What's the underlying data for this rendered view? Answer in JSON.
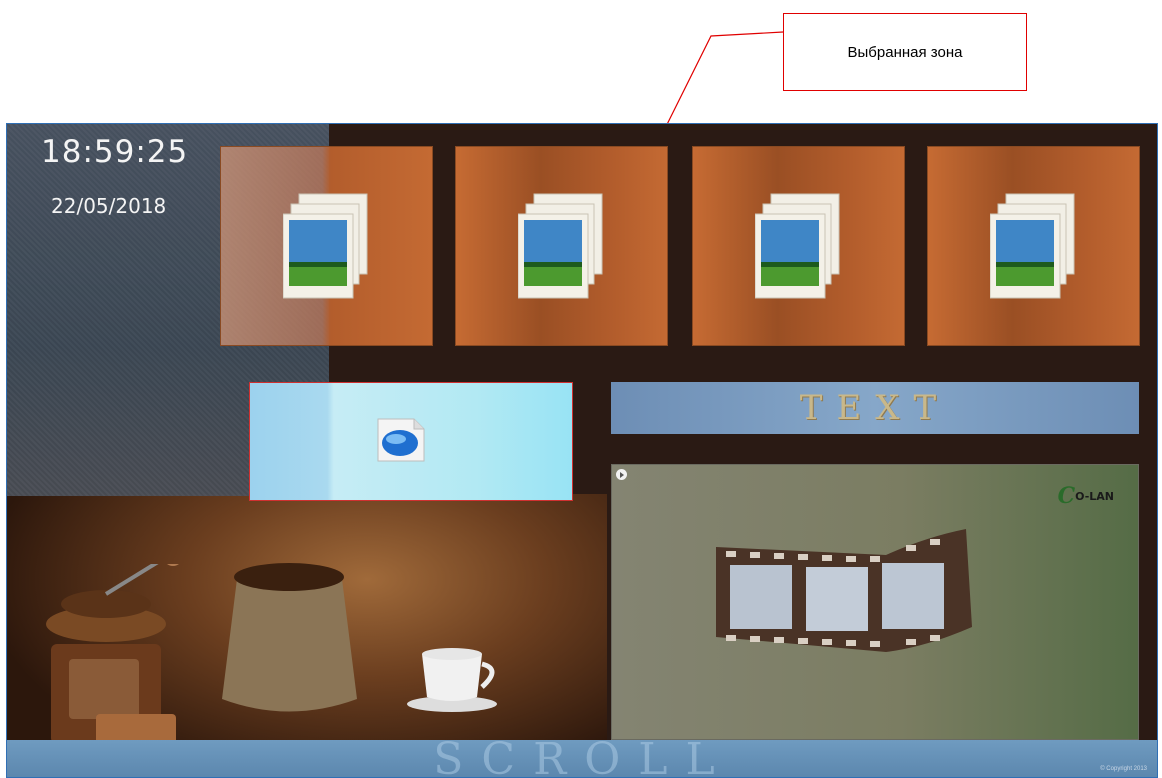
{
  "callout": {
    "label": "Выбранная зона",
    "border_color": "#e00000"
  },
  "clock": {
    "time": "18:59:25",
    "date": "22/05/2018"
  },
  "image_tiles": [
    {
      "icon": "image-icon"
    },
    {
      "icon": "image-icon"
    },
    {
      "icon": "image-icon"
    },
    {
      "icon": "image-icon"
    }
  ],
  "web_zone": {
    "icon": "web-page-icon",
    "border_color": "#d03030"
  },
  "text_banner": {
    "text": "TEXT"
  },
  "video_zone": {
    "icon": "film-strip-icon",
    "logo": {
      "initial": "C",
      "text": "O-LAN"
    }
  },
  "scroll_banner": {
    "text": "SCROLL",
    "copyright": "© Copyright 2013"
  },
  "colors": {
    "screen_border": "#2f6fb5",
    "tile": "#b35d2c",
    "frame": "#2a1a14"
  }
}
